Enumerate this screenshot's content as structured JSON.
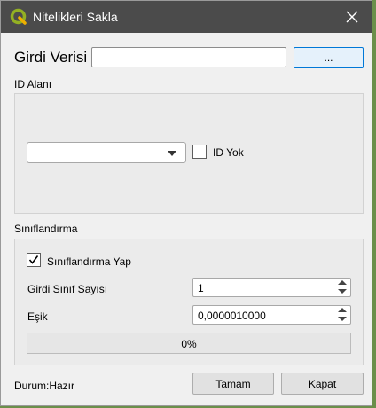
{
  "window": {
    "title": "Nitelikleri Sakla",
    "app_icon": "qgis-logo-icon",
    "close_icon": "close-icon"
  },
  "input": {
    "label": "Girdi Verisi",
    "value": "",
    "browse_label": "..."
  },
  "id_section": {
    "label": "ID Alanı",
    "combo_value": "",
    "no_id_label": "ID Yok",
    "no_id_checked": false
  },
  "classification": {
    "label": "Sınıflandırma",
    "do_label": "Sınıflandırma Yap",
    "do_checked": true,
    "class_count_label": "Girdi Sınıf Sayısı",
    "class_count_value": "1",
    "threshold_label": "Eşik",
    "threshold_value": "0,0000010000",
    "progress_text": "0%",
    "progress": 0
  },
  "footer": {
    "status": "Durum:Hazır",
    "ok_label": "Tamam",
    "close_label": "Kapat"
  },
  "colors": {
    "titlebar": "#4b4b4b",
    "accent": "#0078d7",
    "progress": "#06b025"
  }
}
